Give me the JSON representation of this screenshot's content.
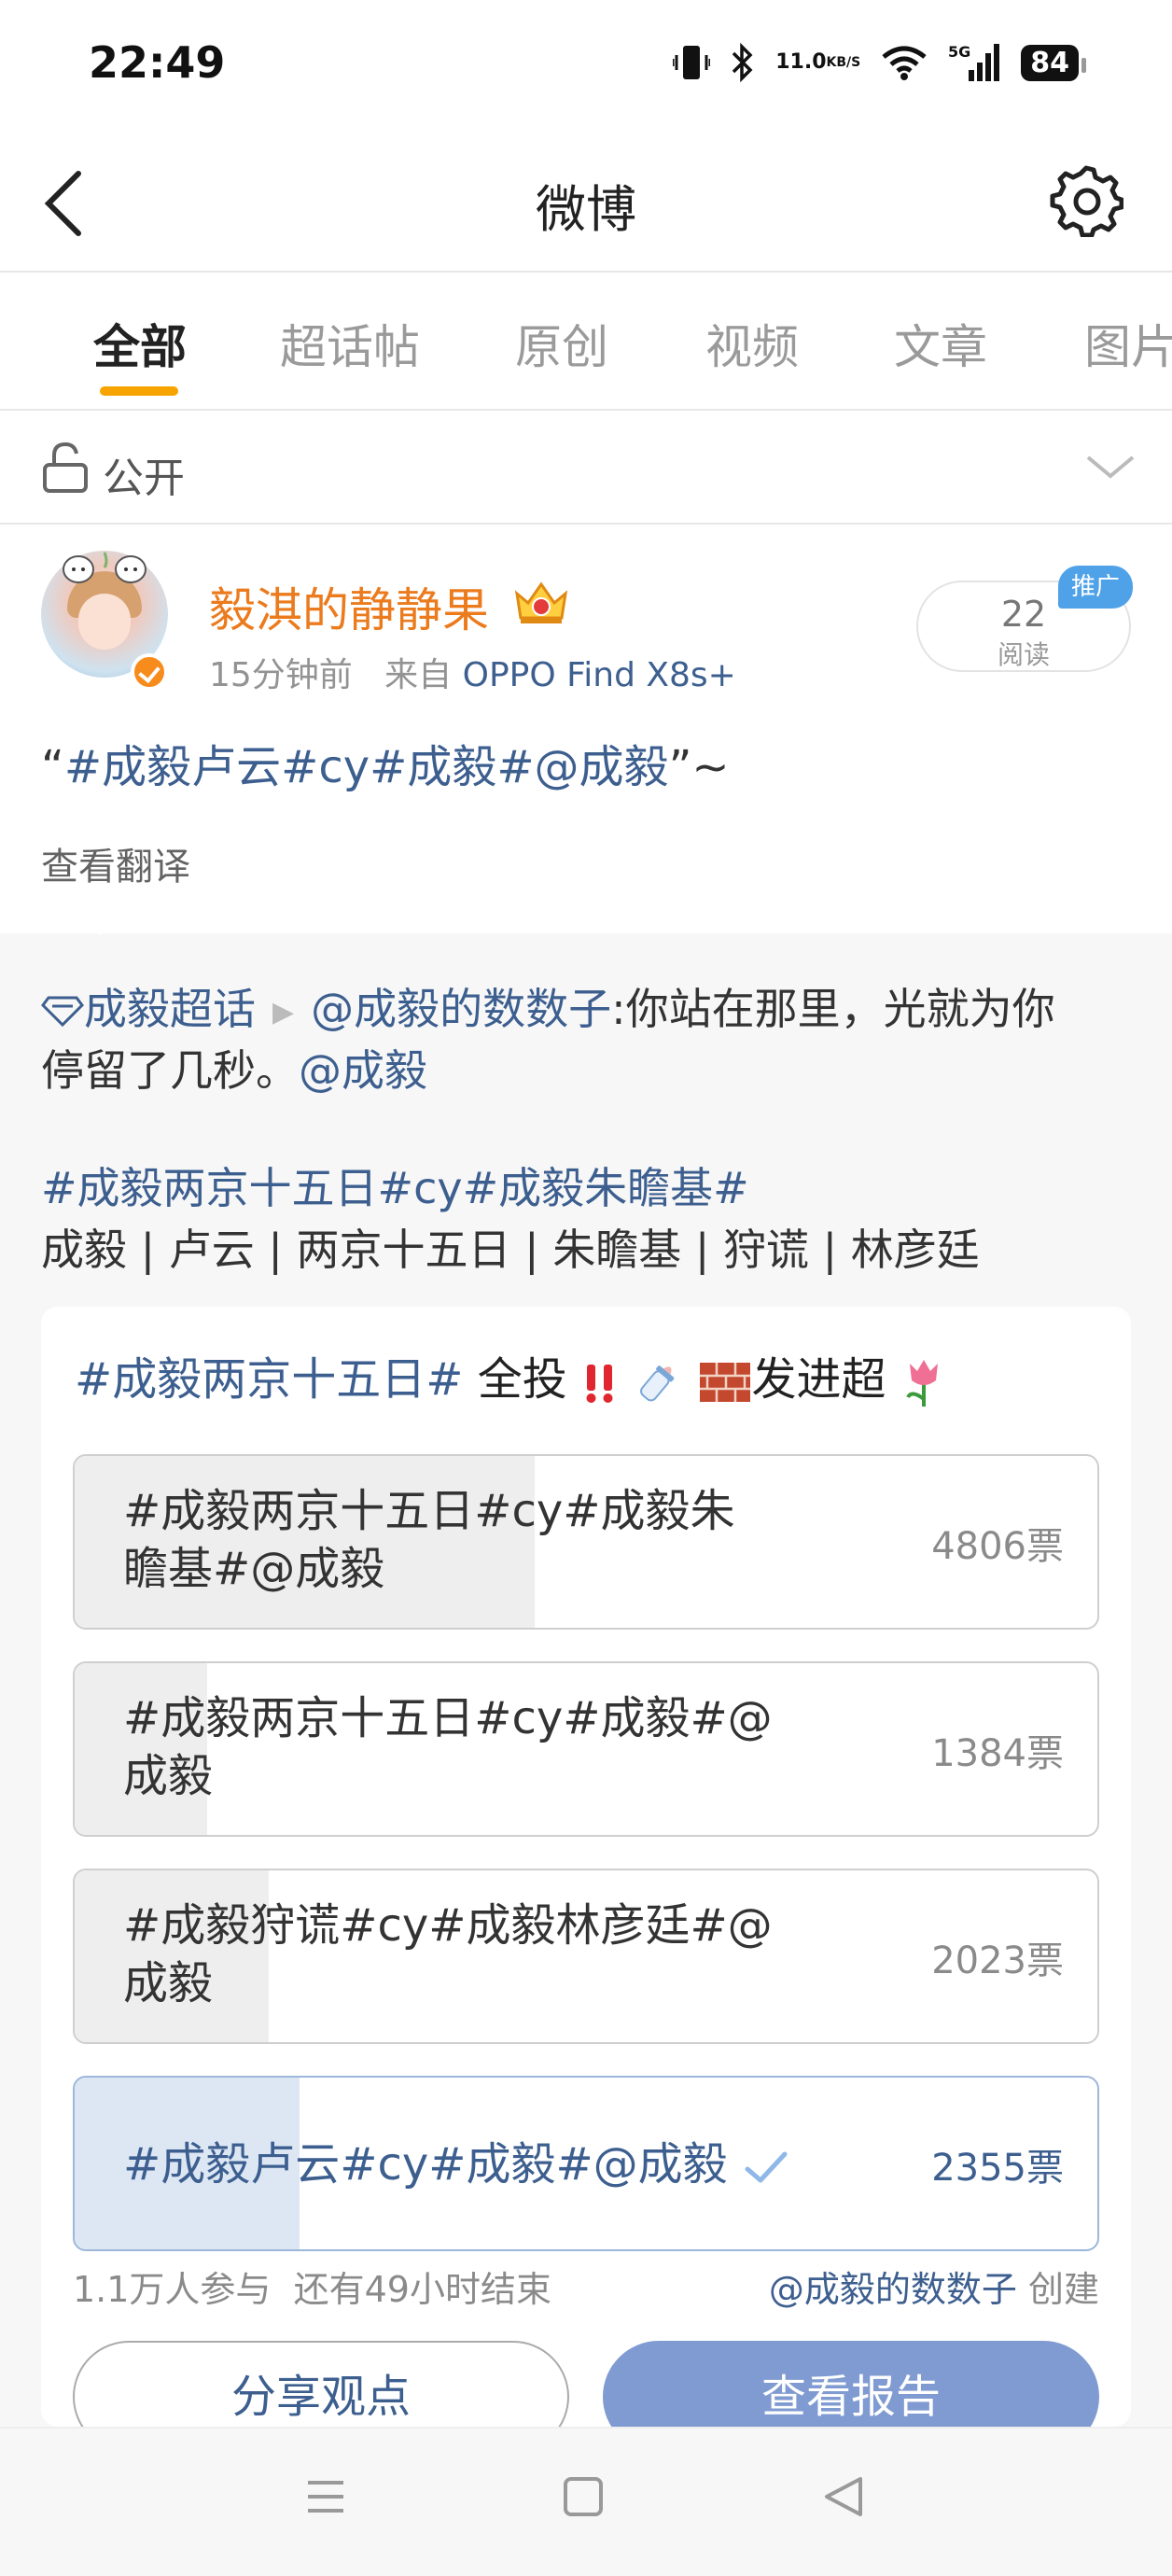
{
  "status_bar": {
    "time": "22:49",
    "net_speed_value": "11.0",
    "net_speed_unit": "KB/S",
    "signal_label": "5G",
    "battery": "84"
  },
  "nav": {
    "title": "微博"
  },
  "tabs": [
    {
      "label": "全部",
      "active": true
    },
    {
      "label": "超话帖",
      "active": false
    },
    {
      "label": "原创",
      "active": false
    },
    {
      "label": "视频",
      "active": false
    },
    {
      "label": "文章",
      "active": false
    },
    {
      "label": "图片",
      "active": false
    }
  ],
  "visibility": {
    "label": "公开"
  },
  "post": {
    "user_name": "毅淇的静静果",
    "time_ago": "15分钟前",
    "source_prefix": "来自",
    "source_device": "OPPO Find X8s+",
    "reads_count": "22",
    "reads_label": "阅读",
    "promo_label": "推广",
    "text_open_quote": "“",
    "text_topics": "#成毅卢云#cy#成毅#@成毅",
    "text_close": "”~",
    "translate_label": "查看翻译"
  },
  "repost": {
    "supertopic": "成毅超话",
    "author_mention": "@成毅的数数子",
    "text_part1": ":你站在那里，光就为你",
    "text_part2": "停留了几秒。",
    "text_mention": "@成毅",
    "topic_line": "#成毅两京十五日#cy#成毅朱瞻基#",
    "names_line": "成毅 | 卢云 | 两京十五日 | 朱瞻基  | 狩谎 | 林彦廷"
  },
  "poll": {
    "title_topic": "#成毅两京十五日#",
    "title_text1": " 全投",
    "title_text2": "发进超",
    "options": [
      {
        "line1": "#成毅两京十五日#cy#成毅朱",
        "line2": "瞻基#@成毅",
        "votes": "4806票",
        "fraction": 0.45,
        "selected": false
      },
      {
        "line1": "#成毅两京十五日#cy#成毅#@",
        "line2": "成毅",
        "votes": "1384票",
        "fraction": 0.13,
        "selected": false
      },
      {
        "line1": "#成毅狩谎#cy#成毅林彦廷#@",
        "line2": "成毅",
        "votes": "2023票",
        "fraction": 0.19,
        "selected": false
      },
      {
        "line1": "#成毅卢云#cy#成毅#@成毅",
        "line2": "",
        "votes": "2355票",
        "fraction": 0.22,
        "selected": true
      }
    ],
    "participants": "1.1万人参与",
    "time_left": "还有49小时结束",
    "creator_name": "@成毅的数数子",
    "creator_suffix": " 创建",
    "share_label": "分享观点",
    "report_label": "查看报告"
  },
  "colors": {
    "accent_orange": "#f7a400",
    "username_orange": "#eb7b1d",
    "link_blue": "#3d5f8f",
    "report_button": "#7f9bd1"
  },
  "icons": [
    "back-arrow-icon",
    "gear-icon",
    "lock-icon",
    "chevron-down-icon",
    "crown-icon",
    "verified-icon",
    "supertopic-diamond-icon",
    "check-icon",
    "menu-icon",
    "home-icon",
    "back-triangle-icon"
  ]
}
